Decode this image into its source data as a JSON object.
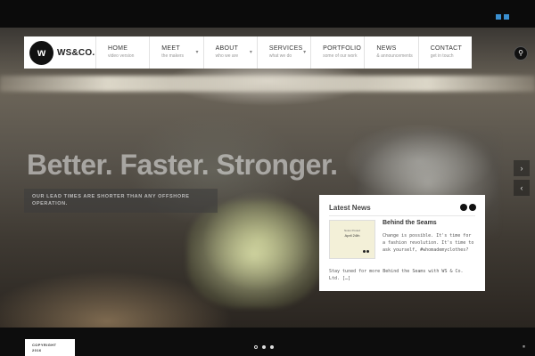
{
  "social": {
    "icons": [
      "twitter-icon",
      "linkedin-icon"
    ]
  },
  "logo": {
    "mark": "w",
    "text": "WS&CO."
  },
  "nav": {
    "items": [
      {
        "title": "HOME",
        "subtitle": "video version",
        "has_dropdown": false
      },
      {
        "title": "MEET",
        "subtitle": "the makers",
        "has_dropdown": true
      },
      {
        "title": "ABOUT",
        "subtitle": "who we are",
        "has_dropdown": true
      },
      {
        "title": "SERVICES",
        "subtitle": "what we do",
        "has_dropdown": true
      },
      {
        "title": "PORTFOLIO",
        "subtitle": "some of our work",
        "has_dropdown": false
      },
      {
        "title": "NEWS",
        "subtitle": "& announcements",
        "has_dropdown": false
      },
      {
        "title": "CONTACT",
        "subtitle": "get in touch",
        "has_dropdown": false
      }
    ],
    "caret": "▾"
  },
  "search": {
    "icon": "search-icon",
    "glyph": "⚲"
  },
  "hero": {
    "headline": "Better. Faster. Stronger.",
    "sub_line1": "OUR LEAD TIMES ARE SHORTER THAN ANY OFFSHORE",
    "sub_line2": "OPERATION."
  },
  "news": {
    "title": "Latest News",
    "thumb_line1": "Notes Posted",
    "thumb_line2": "April 24th",
    "post_title": "Behind the Seams",
    "excerpt": "Change is possible. It's time for a fashion revolution. It's time to ask yourself, #whomademyclothes?",
    "excerpt_cont": "Stay tuned for more Behind the Seams with WS & Co. Ltd. […]"
  },
  "slider": {
    "next_glyph": "›",
    "prev_glyph": "‹",
    "pause_glyph": "⏸",
    "pages": 3,
    "active_page": 0
  },
  "footer": {
    "copyright_line1": "COPYRIGHT",
    "copyright_line2": "2016"
  },
  "colors": {
    "accent": "#3a8fd0",
    "panel": "#ffffff",
    "dark": "#111111"
  }
}
